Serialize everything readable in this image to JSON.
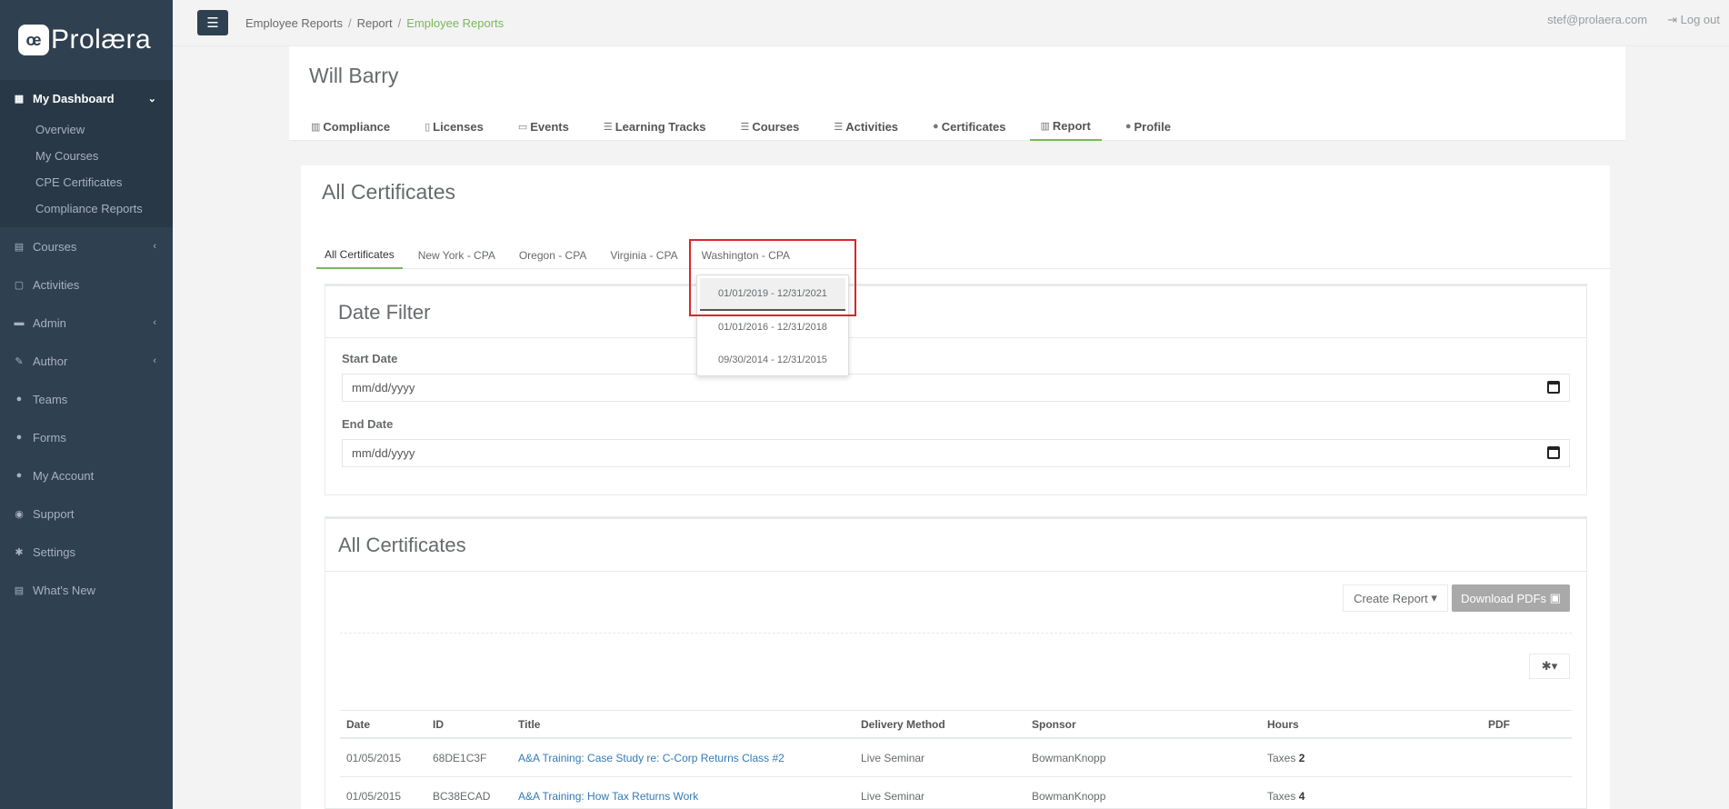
{
  "brand": {
    "logo_mark": "œ",
    "name": "Prolæra"
  },
  "sidebar": {
    "items": [
      {
        "label": "My Dashboard",
        "icon": "dashboard-icon"
      },
      {
        "label": "Courses",
        "icon": "book-icon"
      },
      {
        "label": "Activities",
        "icon": "file-icon"
      },
      {
        "label": "Admin",
        "icon": "briefcase-icon"
      },
      {
        "label": "Author",
        "icon": "edit-icon"
      },
      {
        "label": "Teams",
        "icon": "users-icon"
      },
      {
        "label": "Forms",
        "icon": "users-icon"
      },
      {
        "label": "My Account",
        "icon": "user-icon"
      },
      {
        "label": "Support",
        "icon": "lifebuoy-icon"
      },
      {
        "label": "Settings",
        "icon": "cog-icon"
      },
      {
        "label": "What's New",
        "icon": "newspaper-icon"
      }
    ],
    "submenu": [
      "Overview",
      "My Courses",
      "CPE Certificates",
      "Compliance Reports"
    ]
  },
  "topbar": {
    "breadcrumb": [
      "Employee Reports",
      "Report",
      "Employee Reports"
    ],
    "email": "stef@prolaera.com",
    "logout": "Log out"
  },
  "profile": {
    "name": "Will Barry",
    "tabs": [
      "Compliance",
      "Licenses",
      "Events",
      "Learning Tracks",
      "Courses",
      "Activities",
      "Certificates",
      "Report",
      "Profile"
    ],
    "active_tab": "Report"
  },
  "certificates": {
    "title": "All Certificates",
    "tabs": [
      "All Certificates",
      "New York - CPA",
      "Oregon - CPA",
      "Virginia - CPA",
      "Washington - CPA"
    ],
    "active_tab": "All Certificates",
    "dropdown": [
      "01/01/2019 - 12/31/2021",
      "01/01/2016 - 12/31/2018",
      "09/30/2014 - 12/31/2015"
    ]
  },
  "date_filter": {
    "title": "Date Filter",
    "start_label": "Start Date",
    "start_placeholder": "mm/dd/yyyy",
    "end_label": "End Date",
    "end_placeholder": "mm/dd/yyyy"
  },
  "cert_table": {
    "title": "All Certificates",
    "create_report": "Create Report",
    "download_pdfs": "Download PDFs",
    "columns": [
      "Date",
      "ID",
      "Title",
      "Delivery Method",
      "Sponsor",
      "Hours",
      "PDF"
    ],
    "rows": [
      {
        "date": "01/05/2015",
        "id": "68DE1C3F",
        "title": "A&A Training: Case Study re: C-Corp Returns Class #2",
        "delivery": "Live Seminar",
        "sponsor": "BowmanKnopp",
        "hours_label": "Taxes",
        "hours_num": "2",
        "pdf": ""
      },
      {
        "date": "01/05/2015",
        "id": "BC38ECAD",
        "title": "A&A Training: How Tax Returns Work",
        "delivery": "Live Seminar",
        "sponsor": "BowmanKnopp",
        "hours_label": "Taxes",
        "hours_num": "4",
        "pdf": ""
      }
    ]
  }
}
